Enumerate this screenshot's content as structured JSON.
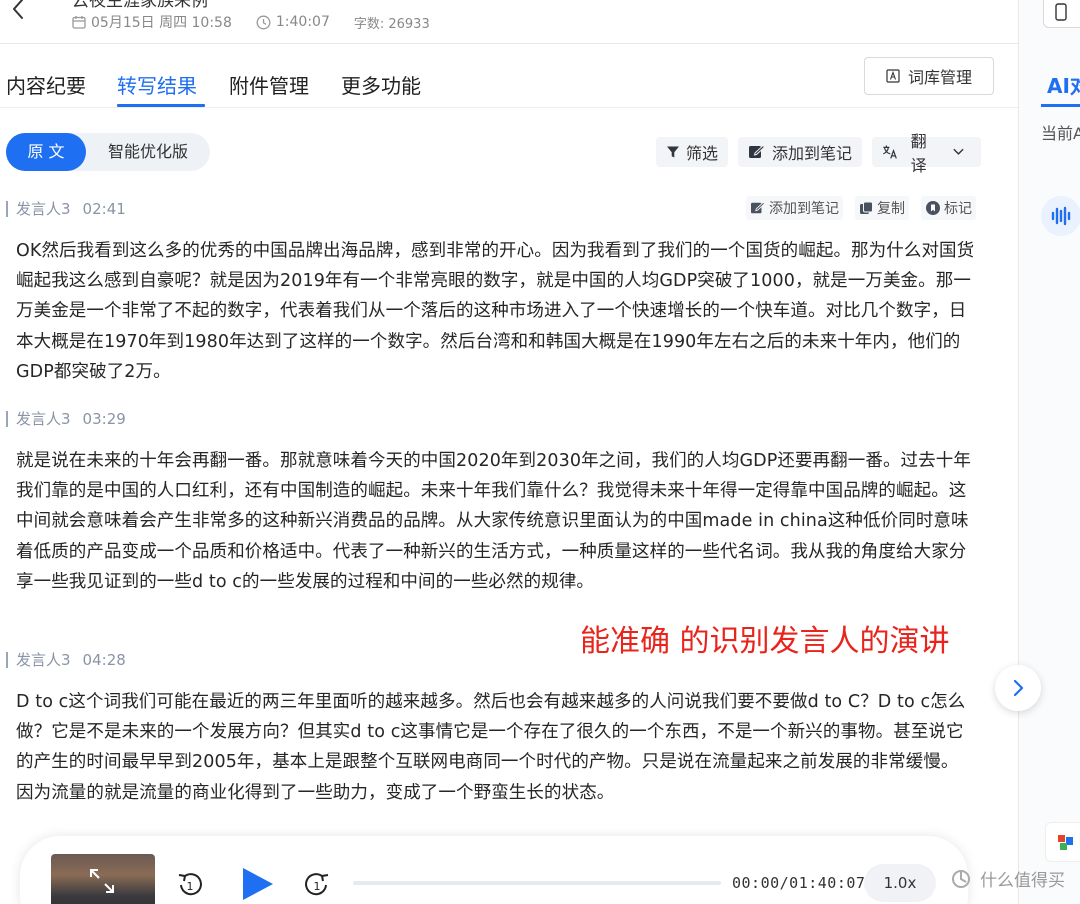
{
  "header": {
    "title": "云夜生涯家族来例",
    "date": "05月15日 周四 10:58",
    "duration": "1:40:07",
    "word_count": "字数: 26933"
  },
  "tabs": [
    {
      "label": "内容纪要"
    },
    {
      "label": "转写结果"
    },
    {
      "label": "附件管理"
    },
    {
      "label": "更多功能"
    }
  ],
  "lexicon_button": "词库管理",
  "toggle": {
    "original": "原 文",
    "optimized": "智能优化版"
  },
  "toolbar": {
    "filter": "筛选",
    "add_note": "添加到笔记",
    "translate": "翻译"
  },
  "segment_actions": {
    "add_note": "添加到笔记",
    "copy": "复制",
    "mark": "标记"
  },
  "segments": [
    {
      "speaker": "发言人3",
      "time": "02:41",
      "text": "OK然后我看到这么多的优秀的中国品牌出海品牌，感到非常的开心。因为我看到了我们的一个国货的崛起。那为什么对国货崛起我这么感到自豪呢？就是因为2019年有一个非常亮眼的数字，就是中国的人均GDP突破了1000，就是一万美金。那一万美金是一个非常了不起的数字，代表着我们从一个落后的这种市场进入了一个快速增长的一个快车道。对比几个数字，日本大概是在1970年到1980年达到了这样的一个数字。然后台湾和和韩国大概是在1990年左右之后的未来十年内，他们的GDP都突破了2万。"
    },
    {
      "speaker": "发言人3",
      "time": "03:29",
      "text": "就是说在未来的十年会再翻一番。那就意味着今天的中国2020年到2030年之间，我们的人均GDP还要再翻一番。过去十年我们靠的是中国的人口红利，还有中国制造的崛起。未来十年我们靠什么？我觉得未来十年得一定得靠中国品牌的崛起。这中间就会意味着会产生非常多的这种新兴消费品的品牌。从大家传统意识里面认为的中国made in china这种低价同时意味着低质的产品变成一个品质和价格适中。代表了一种新兴的生活方式，一种质量这样的一些代名词。我从我的角度给大家分享一些我见证到的一些d to c的一些发展的过程和中间的一些必然的规律。"
    },
    {
      "speaker": "发言人3",
      "time": "04:28",
      "text": "D to c这个词我们可能在最近的两三年里面听的越来越多。然后也会有越来越多的人问说我们要不要做d to C？D to c怎么做？它是不是未来的一个发展方向？但其实d to c这事情它是一个存在了很久的一个东西，不是一个新兴的事物。甚至说它的产生的时间最早早到2005年，基本上是跟整个互联网电商同一个时代的产物。只是说在流量起来之前发展的非常缓慢。因为流量的就是流量的商业化得到了一些助力，变成了一个野蛮生长的状态。"
    }
  ],
  "annotation": "能准确 的识别发言人的演讲",
  "player": {
    "time": "00:00/01:40:07",
    "speed": "1.0x",
    "progress": 0
  },
  "right_panel": {
    "ai_tab": "AI对",
    "subtitle": "当前A"
  },
  "watermark": "什么值得买",
  "colors": {
    "accent": "#1f6ff2",
    "annotation": "#e8241c"
  }
}
